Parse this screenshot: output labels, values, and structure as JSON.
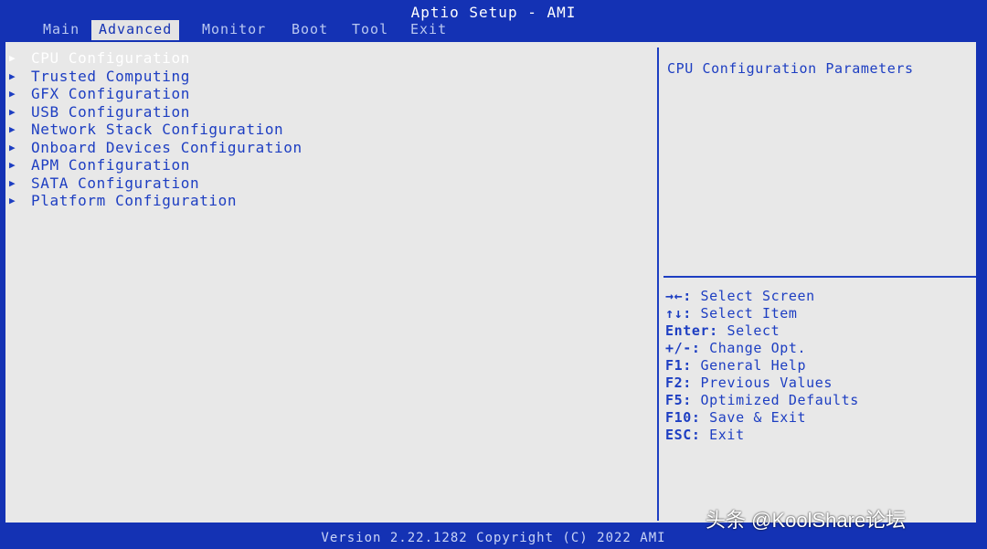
{
  "header": {
    "title": "Aptio Setup - AMI"
  },
  "tabs": [
    {
      "label": "Main"
    },
    {
      "label": "Advanced"
    },
    {
      "label": "Monitor"
    },
    {
      "label": "Boot"
    },
    {
      "label": "Tool"
    },
    {
      "label": "Exit"
    }
  ],
  "menu": {
    "items": [
      {
        "label": "CPU Configuration"
      },
      {
        "label": "Trusted Computing"
      },
      {
        "label": "GFX Configuration"
      },
      {
        "label": "USB Configuration"
      },
      {
        "label": "Network Stack Configuration"
      },
      {
        "label": "Onboard Devices Configuration"
      },
      {
        "label": "APM Configuration"
      },
      {
        "label": "SATA Configuration"
      },
      {
        "label": "Platform Configuration"
      }
    ],
    "arrow_glyph": "▶"
  },
  "help": {
    "text": "CPU Configuration Parameters"
  },
  "keys": [
    {
      "key": "→←:",
      "desc": "Select Screen"
    },
    {
      "key": "↑↓:",
      "desc": "Select Item"
    },
    {
      "key": "Enter:",
      "desc": "Select"
    },
    {
      "key": "+/-:",
      "desc": "Change Opt."
    },
    {
      "key": "F1:",
      "desc": "General Help"
    },
    {
      "key": "F2:",
      "desc": "Previous Values"
    },
    {
      "key": "F5:",
      "desc": "Optimized Defaults"
    },
    {
      "key": "F10:",
      "desc": "Save & Exit"
    },
    {
      "key": "ESC:",
      "desc": "Exit"
    }
  ],
  "footer": {
    "version": "Version 2.22.1282 Copyright (C) 2022 AMI"
  },
  "watermark": {
    "text": "头条 @KoolShare论坛"
  },
  "colors": {
    "bios_blue": "#1432b4",
    "panel_bg": "#e8e8e8",
    "text_blue": "#1d3ec2"
  }
}
